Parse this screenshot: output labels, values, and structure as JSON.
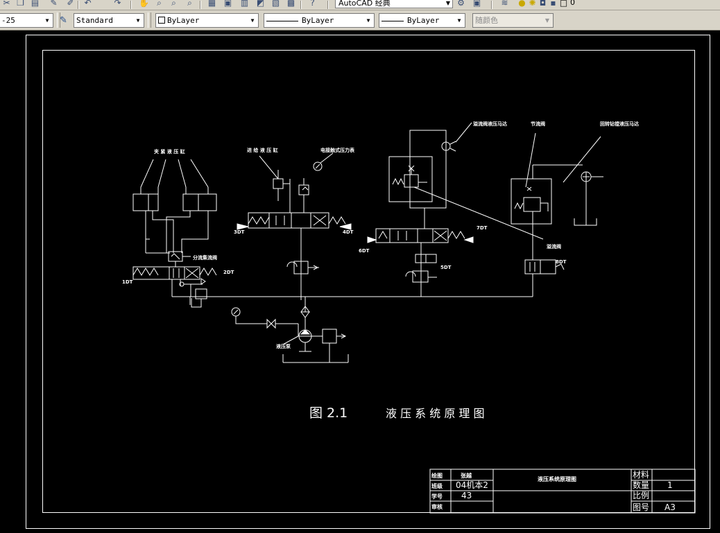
{
  "toolbar": {
    "workspace_value": "AutoCAD 经典",
    "layer_value": "0",
    "dimstyle_value": "-25",
    "textstyle_value": "Standard",
    "color_value": "ByLayer",
    "linetype_value": "ByLayer",
    "lineweight_value": "ByLayer",
    "plotstyle_value": "随颜色"
  },
  "drawing": {
    "caption_fig": "图 2.1",
    "caption_title": "液 压 系 统 原 理 图",
    "labels": {
      "clamp_cylinder": "夹 紧 液 压 缸",
      "feed_cylinder": "进 给 液 压 缸",
      "pressure_relay": "电接触式压力表",
      "pressure_gauge_left": "溢流阀液压马达",
      "throttle": "节流阀",
      "motor_right": "回转钻镗液压马达",
      "flow_divider": "分流集流阀",
      "relief": "溢流阀",
      "pump": "液压泵",
      "sol_1": "1DT",
      "sol_2": "2DT",
      "sol_3": "3DT",
      "sol_4": "4DT",
      "sol_5": "5DT",
      "sol_6": "6DT",
      "sol_7": "7DT",
      "sol_8": "8DT"
    }
  },
  "title_block": {
    "r1_label": "绘图",
    "r1_value": "张越",
    "r2_label": "班级",
    "r2_value": "04机本2",
    "r3_label": "学号",
    "r3_value": "43",
    "r4_label": "审核",
    "drawing_name": "液压系统原理图",
    "material_label": "材料",
    "quantity_label": "数量",
    "quantity_value": "1",
    "scale_label": "比例",
    "drawing_no_label": "图号",
    "drawing_no_value": "A3"
  }
}
